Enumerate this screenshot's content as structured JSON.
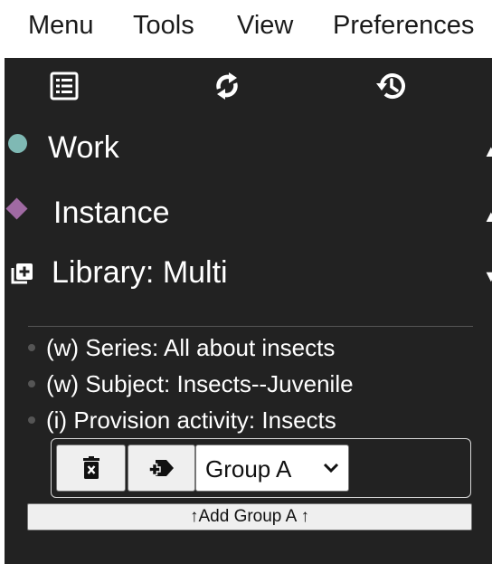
{
  "menubar": {
    "items": [
      "Menu",
      "Tools",
      "View",
      "Preferences"
    ]
  },
  "toolbar": {
    "icons": [
      "list-table-icon",
      "refresh-icon",
      "history-icon"
    ]
  },
  "sections": [
    {
      "label": "Work",
      "icon": "teal-circle-icon",
      "color": "#7fb9b4",
      "state": "collapsed",
      "arrow": "▲"
    },
    {
      "label": "Instance",
      "icon": "purple-diamond-icon",
      "color": "#a06aa3",
      "state": "collapsed",
      "arrow": "▲"
    },
    {
      "label": "Library: Multi",
      "icon": "add-library-icon",
      "color": "#ffffff",
      "state": "expanded",
      "arrow": "▼"
    }
  ],
  "items": [
    "(w) Series: All about insects",
    "(w) Subject: Insects--Juvenile",
    "(i) Provision activity: Insects"
  ],
  "controls": {
    "delete_icon": "delete-icon",
    "move_icon": "add-to-group-icon",
    "group_select_value": "Group A",
    "add_group_label": "↑Add Group A ↑"
  }
}
